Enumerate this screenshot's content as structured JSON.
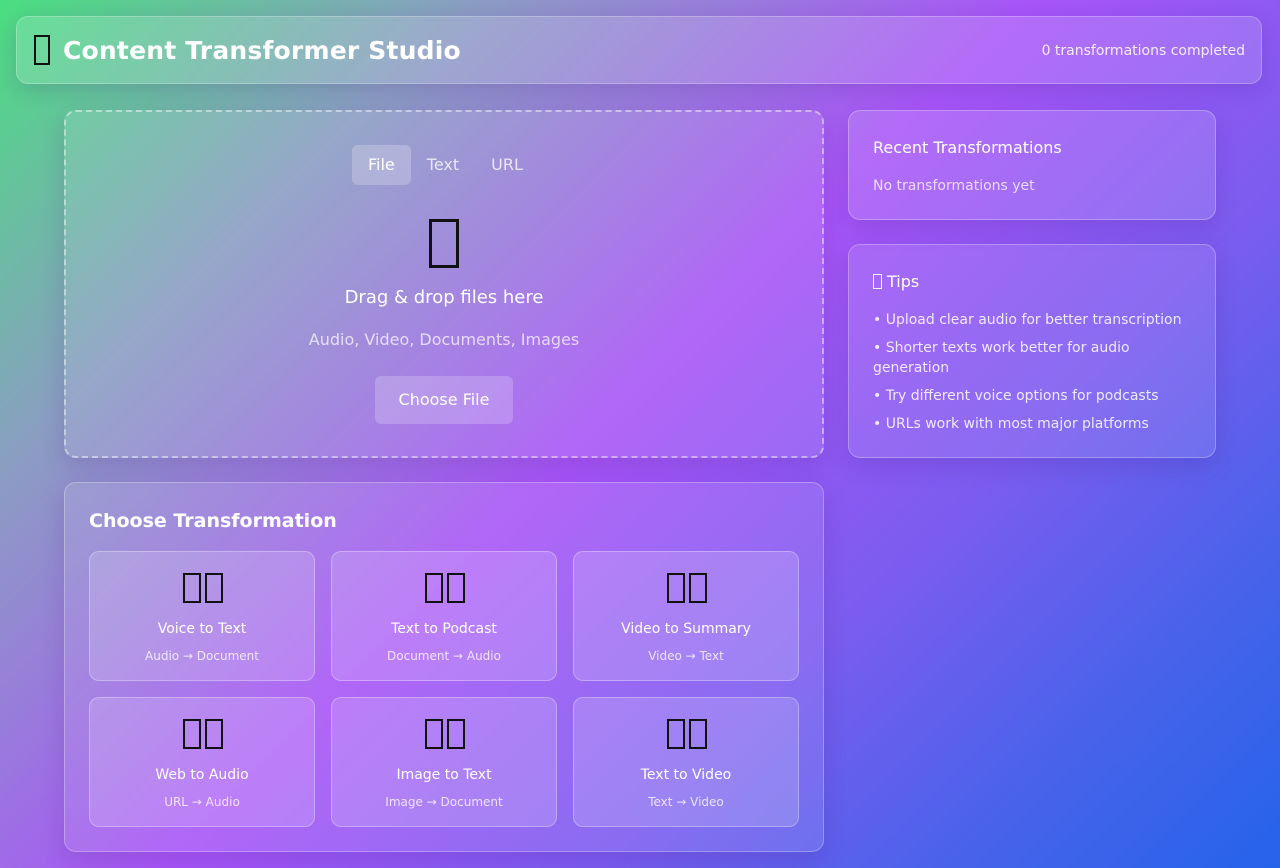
{
  "header": {
    "title": "Content Transformer Studio",
    "status": "0 transformations completed",
    "logo_icon": "box-icon"
  },
  "upload": {
    "tabs": [
      {
        "label": "File",
        "active": true
      },
      {
        "label": "Text",
        "active": false
      },
      {
        "label": "URL",
        "active": false
      }
    ],
    "icon": "upload-folder-icon",
    "title": "Drag & drop files here",
    "subtitle": "Audio, Video, Documents, Images",
    "button_label": "Choose File"
  },
  "recent": {
    "title": "Recent Transformations",
    "empty_text": "No transformations yet"
  },
  "tips": {
    "title": "Tips",
    "icon": "lightbulb-icon",
    "items": [
      "• Upload clear audio for better transcription",
      "• Shorter texts work better for audio generation",
      "• Try different voice options for podcasts",
      "• URLs work with most major platforms"
    ]
  },
  "transformations": {
    "title": "Choose Transformation",
    "cards": [
      {
        "title": "Voice to Text",
        "subtitle": "Audio → Document",
        "icon": "voice-to-text-icon"
      },
      {
        "title": "Text to Podcast",
        "subtitle": "Document → Audio",
        "icon": "text-to-podcast-icon"
      },
      {
        "title": "Video to Summary",
        "subtitle": "Video → Text",
        "icon": "video-to-summary-icon"
      },
      {
        "title": "Web to Audio",
        "subtitle": "URL → Audio",
        "icon": "web-to-audio-icon"
      },
      {
        "title": "Image to Text",
        "subtitle": "Image → Document",
        "icon": "image-to-text-icon"
      },
      {
        "title": "Text to Video",
        "subtitle": "Text → Video",
        "icon": "text-to-video-icon"
      }
    ]
  },
  "colors": {
    "gradient_start": "#4ade80",
    "gradient_mid": "#a855f7",
    "gradient_end": "#2563eb",
    "text": "#ffffff"
  }
}
